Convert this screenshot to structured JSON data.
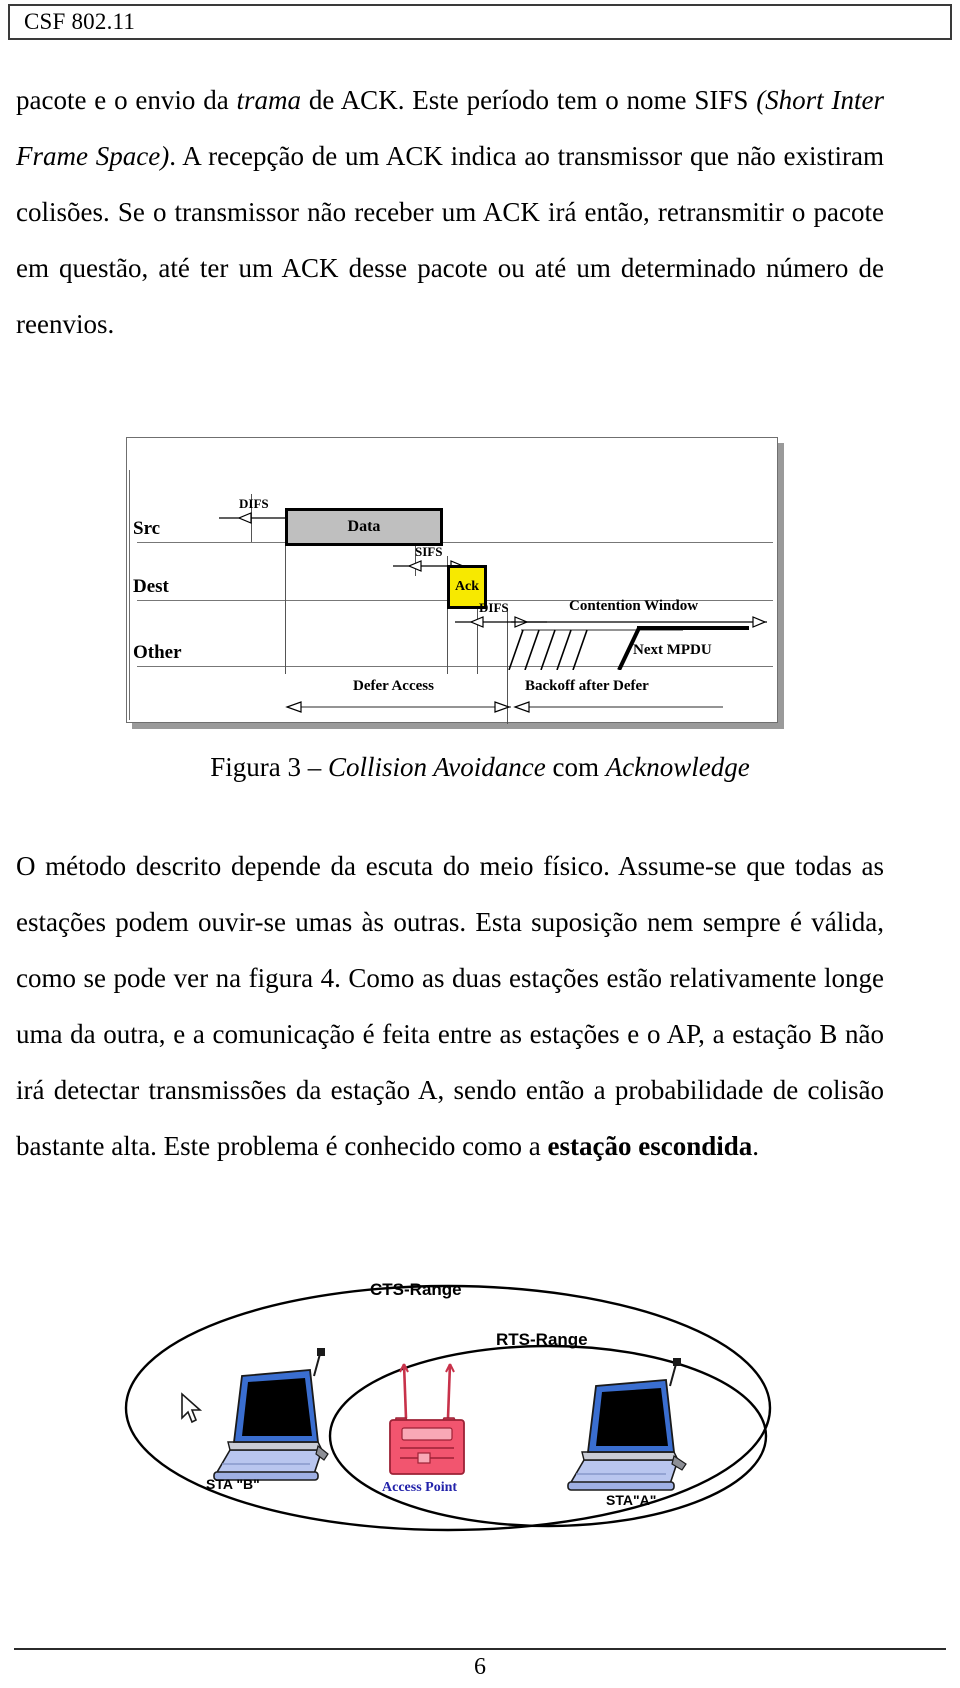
{
  "header": {
    "title": "CSF 802.11"
  },
  "paragraph_1": {
    "seg_1": "pacote e o envio da ",
    "seg_2_italic": "trama",
    "seg_3": " de ACK. Este período tem o nome SIFS ",
    "seg_4_italic": "(Short Inter Frame Space)",
    "seg_5": ". A recepção de um ACK indica ao transmissor que não existiram colisões. Se o transmissor não receber um ACK irá então, retransmitir o pacote em questão, até ter um ACK desse pacote ou até um determinado número de reenvios."
  },
  "figure_3": {
    "rows": [
      {
        "label": "Src"
      },
      {
        "label": "Dest"
      },
      {
        "label": "Other"
      }
    ],
    "packets": [
      {
        "label": "Data",
        "color": "#bfbfbf"
      },
      {
        "label": "Ack",
        "color": "#f7e900"
      }
    ],
    "interval_labels": {
      "difs_top": "DIFS",
      "sifs": "SIFS",
      "difs_bottom": "DIFS",
      "contention_window": "Contention Window",
      "next_mpdu": "Next MPDU",
      "defer_access": "Defer Access",
      "backoff_after_defer": "Backoff after Defer"
    }
  },
  "caption_3": {
    "prefix": "Figura 3 – ",
    "italic_1": "Collision Avoidance",
    "mid": " com ",
    "italic_2": "Acknowledge"
  },
  "paragraph_2": {
    "seg_1": "O método descrito depende da escuta do meio físico. Assume-se que todas as estações podem ouvir-se umas às outras. Esta suposição nem sempre é válida, como se pode ver na figura 4. Como as duas estações estão relativamente longe uma da outra, e a comunicação é feita entre as estações e o AP, a estação B não irá detectar transmissões da estação A, sendo então a probabilidade de colisão bastante alta. Este problema é conhecido como a ",
    "seg_2_bold": "estação escondida",
    "seg_3": "."
  },
  "figure_4": {
    "cts_range": "CTS-Range",
    "rts_range": "RTS-Range",
    "sta_b": "STA \"B\"",
    "sta_a": "STA\"A\"",
    "access_point": "Access Point",
    "colors": {
      "laptop_screen": "#000000",
      "laptop_body": "#8da0e0",
      "laptop_lid": "#3a6ed0",
      "access_point": "#f2556f",
      "access_point_label": "#2222aa"
    }
  },
  "footer": {
    "page_number": "6"
  }
}
